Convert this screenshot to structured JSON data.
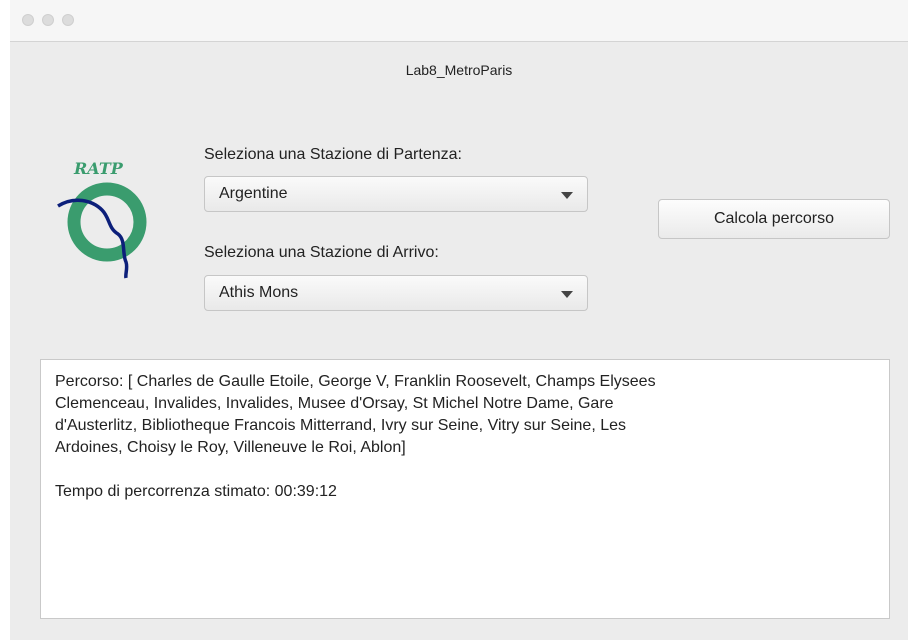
{
  "window": {
    "title": "Lab8_MetroParis"
  },
  "logo": {
    "text": "RATP",
    "color": "#3a9c6e",
    "line_color": "#0c1f7a"
  },
  "departure": {
    "label": "Seleziona una Stazione di Partenza:",
    "selected": "Argentine"
  },
  "arrival": {
    "label": "Seleziona una Stazione di Arrivo:",
    "selected": "Athis Mons"
  },
  "actions": {
    "compute_label": "Calcola percorso"
  },
  "result": {
    "text": "Percorso: [ Charles de Gaulle Etoile, George V, Franklin Roosevelt, Champs Elysees\nClemenceau, Invalides, Invalides, Musee d'Orsay, St Michel Notre Dame, Gare\nd'Austerlitz, Bibliotheque Francois Mitterrand, Ivry sur Seine, Vitry sur Seine, Les\nArdoines, Choisy le Roy, Villeneuve le Roi, Ablon]\n\nTempo di percorrenza stimato: 00:39:12"
  }
}
